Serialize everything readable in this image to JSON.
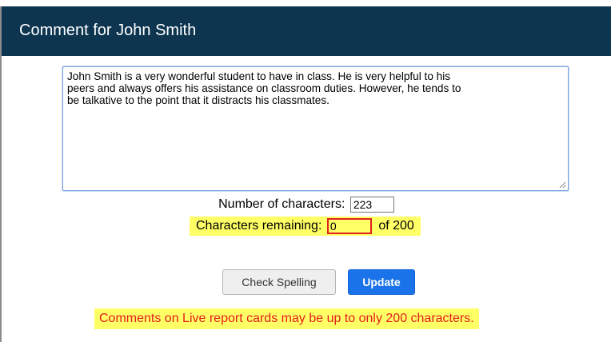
{
  "dialog": {
    "title": "Comment for John Smith"
  },
  "comment": {
    "value": "John Smith is a very wonderful student to have in class. He is very helpful to his\npeers and always offers his assistance on classroom duties. However, he tends to\nbe talkative to the point that it distracts his classmates."
  },
  "counter": {
    "count_label": "Number of characters:",
    "count_value": "223",
    "remaining_label": "Characters remaining:",
    "remaining_value": "0",
    "limit_text": "of 200"
  },
  "buttons": {
    "spell_label": "Check Spelling",
    "update_label": "Update"
  },
  "warning": {
    "text": "Comments on Live report cards may be up to only 200 characters."
  },
  "colors": {
    "titlebar": "#0d3550",
    "highlight": "#ffff66",
    "warning_text": "#e31c1c",
    "update_button": "#1a73e8",
    "remaining_border": "#e32020"
  }
}
